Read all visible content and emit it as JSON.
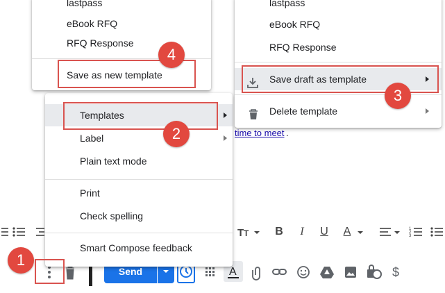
{
  "left_menu": {
    "items_top": [
      "lastpass",
      "eBook RFQ",
      "RFQ Response"
    ],
    "save_new_label": "Save as new template"
  },
  "right_menu": {
    "items_top": [
      "lastpass",
      "eBook RFQ",
      "RFQ Response"
    ],
    "save_draft_label": "Save draft as template",
    "delete_label": "Delete template"
  },
  "main_menu": {
    "templates_label": "Templates",
    "label_label": "Label",
    "plain_text_label": "Plain text mode",
    "print_label": "Print",
    "spelling_label": "Check spelling",
    "smart_compose_label": "Smart Compose feedback"
  },
  "body_link": {
    "text": "time to meet",
    "period": "."
  },
  "badges": {
    "one": "1",
    "two": "2",
    "three": "3",
    "four": "4"
  },
  "bottom_bar": {
    "send_label": "Send"
  },
  "format_bar": {
    "text_size_glyph": "TT",
    "bold": "B",
    "italic": "I",
    "underline": "U",
    "text_color": "A",
    "dollar": "$"
  },
  "colors": {
    "accent": "#1a73e8",
    "badge": "#e2483f",
    "highlight_box": "#d9534f"
  }
}
